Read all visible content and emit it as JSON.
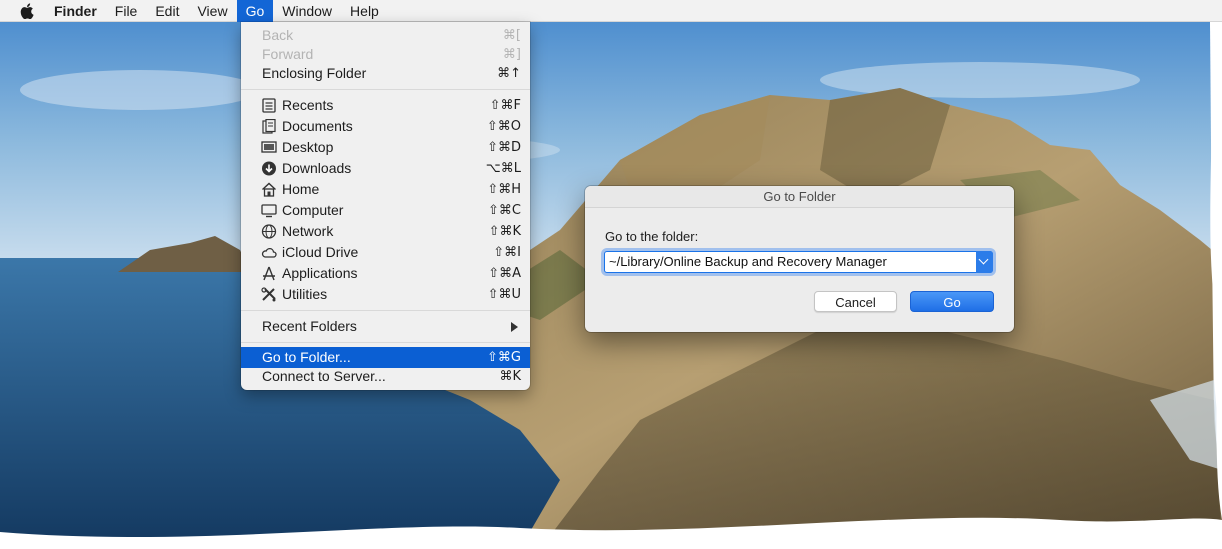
{
  "menubar": {
    "apple_icon": "apple-logo-icon",
    "app_name": "Finder",
    "items": [
      "File",
      "Edit",
      "View",
      "Go",
      "Window",
      "Help"
    ],
    "active_item": "Go"
  },
  "go_menu": {
    "back": {
      "label": "Back",
      "shortcut": "⌘[",
      "enabled": false
    },
    "forward": {
      "label": "Forward",
      "shortcut": "⌘]",
      "enabled": false
    },
    "enclosing": {
      "label": "Enclosing Folder",
      "shortcut": "⌘↑"
    },
    "places": [
      {
        "label": "Recents",
        "shortcut": "⇧⌘F",
        "icon": "recents-icon"
      },
      {
        "label": "Documents",
        "shortcut": "⇧⌘O",
        "icon": "documents-icon"
      },
      {
        "label": "Desktop",
        "shortcut": "⇧⌘D",
        "icon": "desktop-icon"
      },
      {
        "label": "Downloads",
        "shortcut": "⌥⌘L",
        "icon": "downloads-icon"
      },
      {
        "label": "Home",
        "shortcut": "⇧⌘H",
        "icon": "home-icon"
      },
      {
        "label": "Computer",
        "shortcut": "⇧⌘C",
        "icon": "computer-icon"
      },
      {
        "label": "Network",
        "shortcut": "⇧⌘K",
        "icon": "network-icon"
      },
      {
        "label": "iCloud Drive",
        "shortcut": "⇧⌘I",
        "icon": "icloud-icon"
      },
      {
        "label": "Applications",
        "shortcut": "⇧⌘A",
        "icon": "applications-icon"
      },
      {
        "label": "Utilities",
        "shortcut": "⇧⌘U",
        "icon": "utilities-icon"
      }
    ],
    "recent_folders": {
      "label": "Recent Folders"
    },
    "go_to_folder": {
      "label": "Go to Folder...",
      "shortcut": "⇧⌘G",
      "highlighted": true
    },
    "connect": {
      "label": "Connect to Server...",
      "shortcut": "⌘K"
    }
  },
  "dialog": {
    "title": "Go to Folder",
    "prompt": "Go to the folder:",
    "input_value": "~/Library/Online Backup and Recovery Manager",
    "cancel_label": "Cancel",
    "go_label": "Go"
  },
  "colors": {
    "menu_highlight": "#0b5fd3",
    "accent": "#1f6fe6"
  }
}
